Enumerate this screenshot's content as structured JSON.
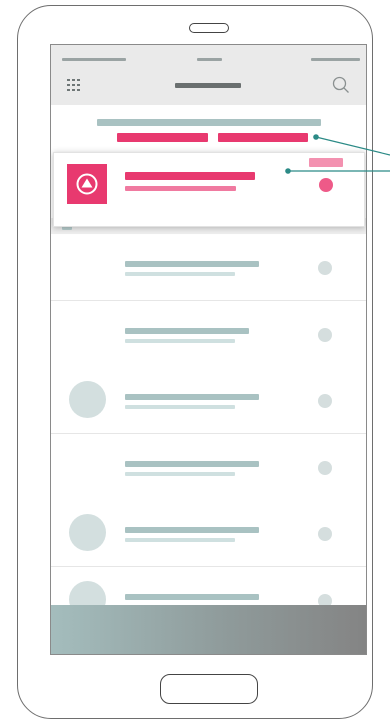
{
  "colors": {
    "accent": "#e8396f",
    "accent_light": "#f07aa0",
    "skeleton": "#a9c2c2",
    "skeleton_light": "#cfe0e0",
    "footer_gradient": [
      "#a4bdbd",
      "#848484"
    ]
  },
  "icons": {
    "menu": "grid-icon",
    "search": "search-icon",
    "featured": "triangle-up-icon"
  },
  "list": {
    "rows": [
      {
        "avatar": false
      },
      {
        "avatar": false
      },
      {
        "avatar": true
      },
      {
        "avatar": false
      },
      {
        "avatar": true
      },
      {
        "avatar": true
      }
    ]
  }
}
